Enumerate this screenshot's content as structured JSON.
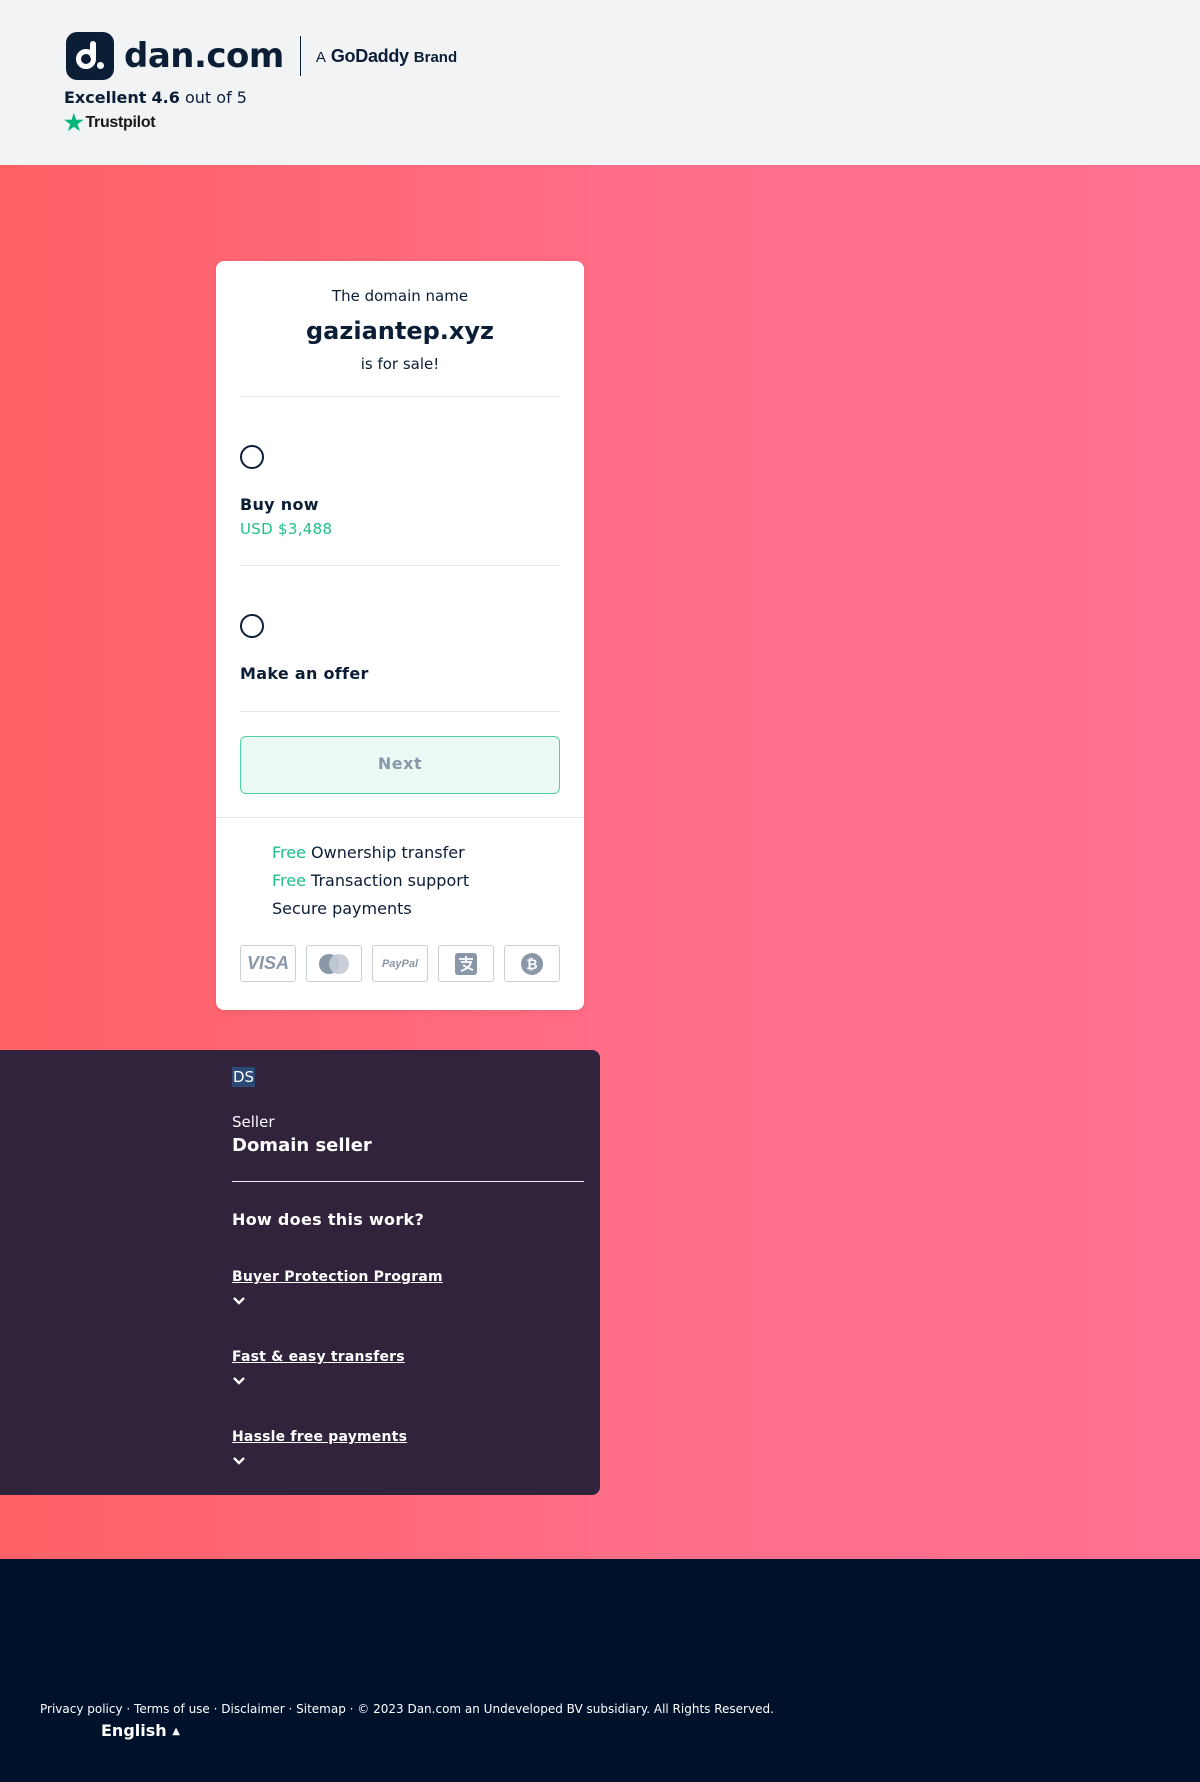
{
  "header": {
    "logo_text": "dan.com",
    "brand_prefix": "A",
    "brand_name": "GoDaddy",
    "brand_suffix": "Brand",
    "rating_label": "Excellent",
    "rating_value": "4.6",
    "rating_suffix": "out of 5",
    "trustpilot": "Trustpilot"
  },
  "card": {
    "intro": "The domain name",
    "domain": "gaziantep.xyz",
    "outro": "is for sale!",
    "options": [
      {
        "title": "Buy now",
        "price": "USD $3,488"
      },
      {
        "title": "Make an offer"
      }
    ],
    "next_label": "Next",
    "perks": [
      {
        "tag": "Free",
        "text": "Ownership transfer"
      },
      {
        "tag": "Free",
        "text": "Transaction support"
      },
      {
        "tag": "",
        "text": "Secure payments"
      }
    ],
    "payment_methods": [
      "visa-icon",
      "mastercard-icon",
      "paypal-icon",
      "alipay-icon",
      "bitcoin-icon"
    ],
    "payment_labels": {
      "visa": "VISA",
      "paypal": "PayPal"
    }
  },
  "seller": {
    "initials": "DS",
    "role": "Seller",
    "name": "Domain seller",
    "how_title": "How does this work?",
    "accordion": [
      {
        "label": "Buyer Protection Program"
      },
      {
        "label": "Fast & easy transfers"
      },
      {
        "label": "Hassle free payments"
      }
    ]
  },
  "footer": {
    "legal": "Privacy policy · Terms of use · Disclaimer · Sitemap · © 2023 Dan.com an Undeveloped BV subsidiary. All Rights Reserved.",
    "language": "English"
  },
  "colors": {
    "accent_green": "#1fbf8a",
    "navy": "#0b1e35",
    "seller_bg": "#30233b",
    "footer_bg": "#00112b",
    "hero_gradient_start": "#ff6165",
    "hero_gradient_end": "#ff7193"
  }
}
